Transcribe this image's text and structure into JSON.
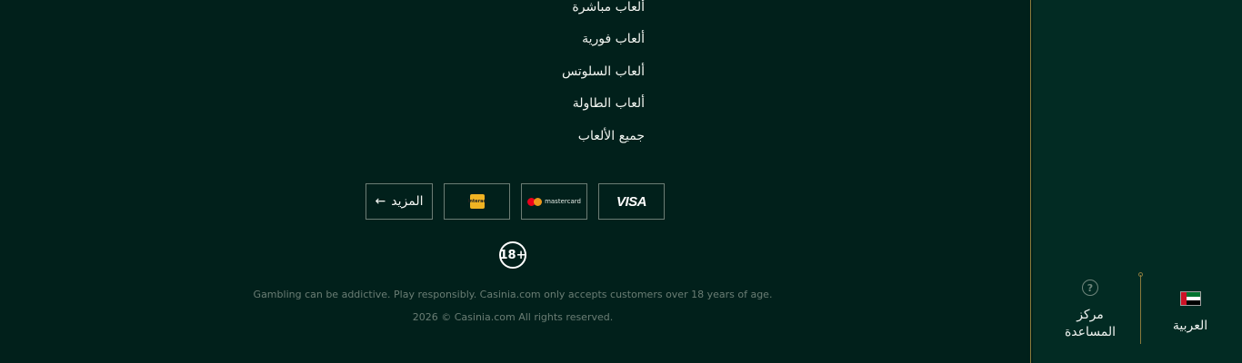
{
  "games_links": [
    "ألعاب مباشرة",
    "ألعاب فورية",
    "ألعاب السلوتس",
    "ألعاب الطاولة",
    "جميع الألعاب"
  ],
  "payments": {
    "more_label": "المزيد",
    "interac_text": "Interac",
    "mastercard_text": "mastercard",
    "visa_text": "VISA"
  },
  "age_badge": "18+",
  "footer": {
    "disclaimer": "Gambling can be addictive. Play responsibly. Casinia.com only accepts customers over 18 years of age.",
    "copyright": "2026 © Casinia.com All rights reserved."
  },
  "sidebar": {
    "help_icon": "?",
    "help_label_line1": "مركز",
    "help_label_line2": "المساعدة",
    "language_label": "العربية"
  },
  "colors": {
    "background": "#01201b",
    "sidebar": "#022b23",
    "accent_gold": "#8a7a3c",
    "muted_text": "#6a7d74"
  }
}
